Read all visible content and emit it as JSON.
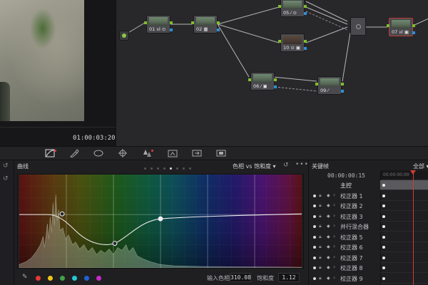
{
  "viewer": {
    "timecode": "01:00:03:20"
  },
  "nodes": [
    {
      "label": "01 ııl ⊙"
    },
    {
      "label": "02 ▦"
    },
    {
      "label": "05 ⁄ ⊙"
    },
    {
      "label": "10 ⊙ ▣"
    },
    {
      "label": "06 ⁄ ▣"
    },
    {
      "label": "09 ⁄"
    },
    {
      "label": "07 ııl ▣"
    }
  ],
  "toolbar": {
    "icons": [
      "curves-icon",
      "qualifier-icon",
      "window-icon",
      "tracker-icon",
      "magic-mask-icon",
      "blur-icon",
      "key-icon",
      "sizing-icon"
    ]
  },
  "curves": {
    "title": "曲线",
    "mode": "色相 vs 饱和度",
    "input_hue_label": "输入色相",
    "input_hue_value": "310.08",
    "saturation_label": "饱和度",
    "saturation_value": "1.12",
    "swatches": [
      "#e53935",
      "#f0c419",
      "#43a047",
      "#26c6da",
      "#1e63d6",
      "#c62bc6"
    ]
  },
  "keyframes": {
    "title": "关键帧",
    "filter": "全部",
    "timecode": "00:00:00:15",
    "ruler_timecode": "00:00:00:00",
    "rows": [
      "主控",
      "校正器 1",
      "校正器 2",
      "校正器 3",
      "并行混合器",
      "校正器 5",
      "校正器 6",
      "校正器 7",
      "校正器 8",
      "校正器 9"
    ]
  }
}
